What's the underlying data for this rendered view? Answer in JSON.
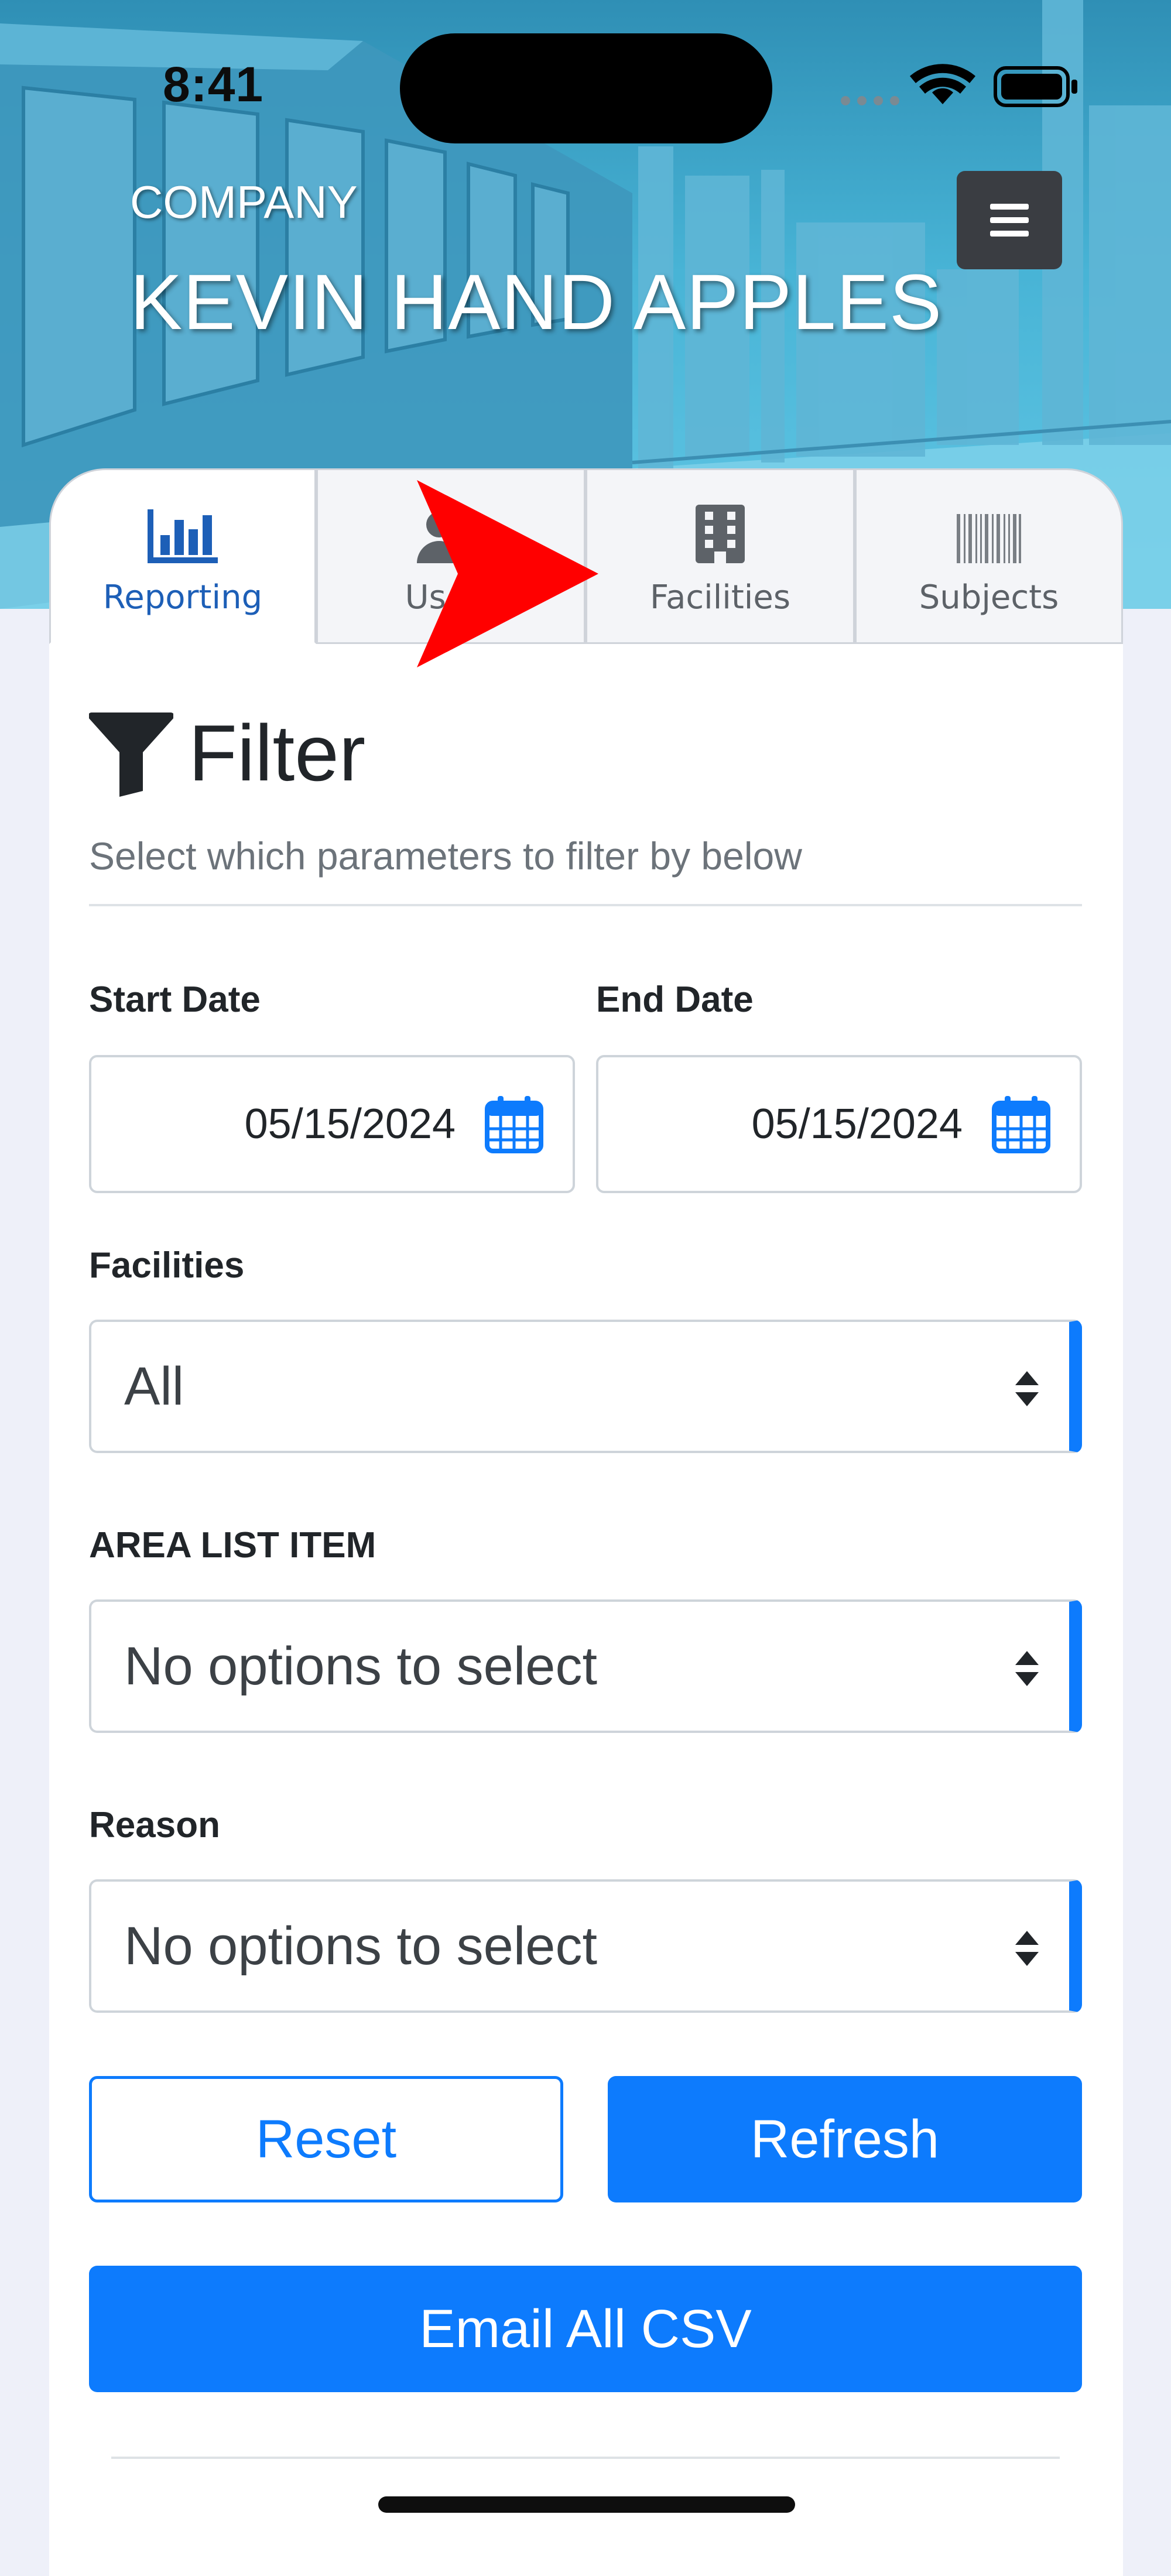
{
  "status_bar": {
    "time": "8:41"
  },
  "header": {
    "company_label": "COMPANY",
    "company_name": "KEVIN HAND APPLES"
  },
  "tabs": [
    {
      "label": "Reporting",
      "icon": "bar-chart-icon",
      "active": true
    },
    {
      "label": "Users",
      "icon": "users-icon",
      "active": false
    },
    {
      "label": "Facilities",
      "icon": "building-icon",
      "active": false
    },
    {
      "label": "Subjects",
      "icon": "barcode-icon",
      "active": false
    }
  ],
  "filter": {
    "title": "Filter",
    "subtitle": "Select which parameters to filter by below",
    "start_date": {
      "label": "Start Date",
      "value": "05/15/2024"
    },
    "end_date": {
      "label": "End Date",
      "value": "05/15/2024"
    },
    "facilities": {
      "label": "Facilities",
      "value": "All"
    },
    "area_list_item": {
      "label": "AREA LIST ITEM",
      "value": "No options to select"
    },
    "reason": {
      "label": "Reason",
      "value": "No options to select"
    }
  },
  "actions": {
    "reset": "Reset",
    "refresh": "Refresh",
    "email_all_csv": "Email All CSV"
  },
  "colors": {
    "primary": "#0d7bfd",
    "tab_active_text": "#1d5fb7",
    "annotation_arrow": "#ff0000",
    "menu_button": "#3a3d42"
  }
}
